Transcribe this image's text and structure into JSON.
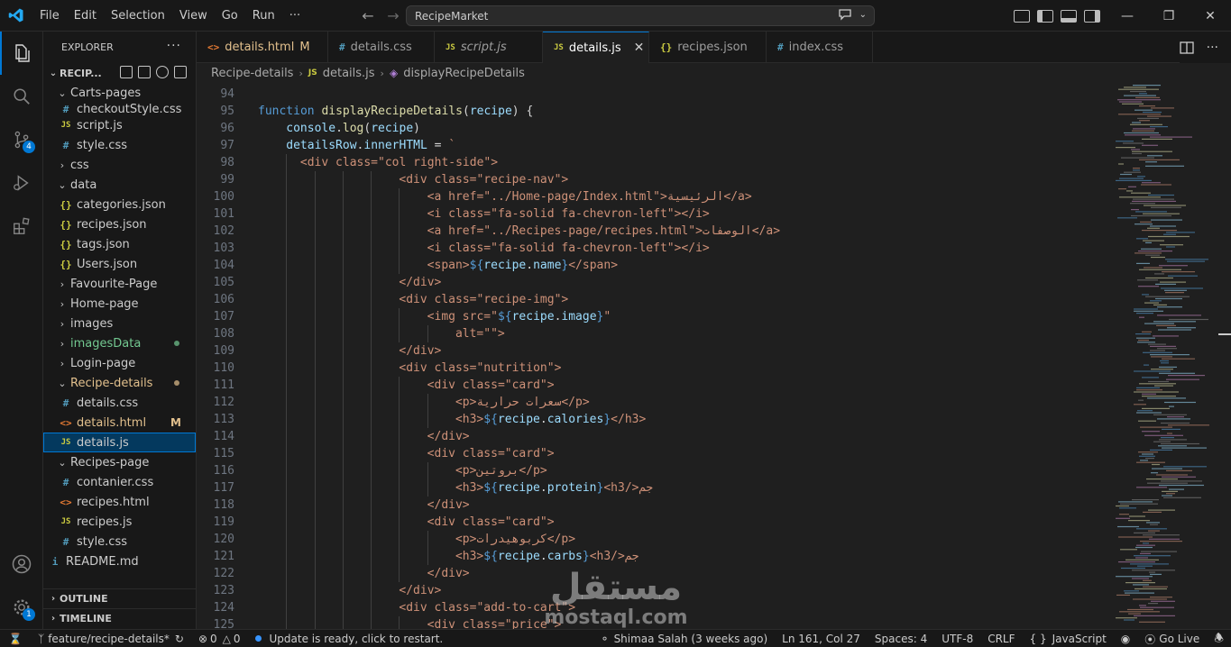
{
  "titlebar": {
    "menu": [
      "File",
      "Edit",
      "Selection",
      "View",
      "Go",
      "Run",
      "···"
    ],
    "search": "RecipeMarket"
  },
  "sidebar": {
    "title": "EXPLORER",
    "project": "RECIP...",
    "items": [
      {
        "label": "Carts-pages",
        "kind": "folder-open",
        "depth": 0
      },
      {
        "label": "checkoutStyle.css",
        "kind": "css",
        "depth": 1
      },
      {
        "label": "script.js",
        "kind": "js",
        "depth": 1
      },
      {
        "label": "style.css",
        "kind": "css",
        "depth": 1
      },
      {
        "label": "css",
        "kind": "folder",
        "depth": 0
      },
      {
        "label": "data",
        "kind": "folder-open",
        "depth": 0
      },
      {
        "label": "categories.json",
        "kind": "json",
        "depth": 1
      },
      {
        "label": "recipes.json",
        "kind": "json",
        "depth": 1
      },
      {
        "label": "tags.json",
        "kind": "json",
        "depth": 1
      },
      {
        "label": "Users.json",
        "kind": "json",
        "depth": 1
      },
      {
        "label": "Favourite-Page",
        "kind": "folder",
        "depth": 0
      },
      {
        "label": "Home-page",
        "kind": "folder",
        "depth": 0
      },
      {
        "label": "images",
        "kind": "folder",
        "depth": 0
      },
      {
        "label": "imagesData",
        "kind": "folder",
        "depth": 0,
        "status": "untracked"
      },
      {
        "label": "Login-page",
        "kind": "folder",
        "depth": 0
      },
      {
        "label": "Recipe-details",
        "kind": "folder-open",
        "depth": 0,
        "status": "modified"
      },
      {
        "label": "details.css",
        "kind": "css",
        "depth": 1
      },
      {
        "label": "details.html",
        "kind": "html",
        "depth": 1,
        "status": "modified",
        "mark": "M"
      },
      {
        "label": "details.js",
        "kind": "js",
        "depth": 1,
        "selected": true
      },
      {
        "label": "Recipes-page",
        "kind": "folder-open",
        "depth": 0
      },
      {
        "label": "contanier.css",
        "kind": "css",
        "depth": 1
      },
      {
        "label": "recipes.html",
        "kind": "html",
        "depth": 1
      },
      {
        "label": "recipes.js",
        "kind": "js",
        "depth": 1
      },
      {
        "label": "style.css",
        "kind": "css",
        "depth": 1
      },
      {
        "label": "README.md",
        "kind": "md",
        "depth": -1
      }
    ],
    "outline": "OUTLINE",
    "timeline": "TIMELINE"
  },
  "activity": {
    "source_control_badge": "4",
    "accounts_badge": "1"
  },
  "tabs": [
    {
      "label": "details.html",
      "kind": "html",
      "mark": "M",
      "modified": true
    },
    {
      "label": "details.css",
      "kind": "css"
    },
    {
      "label": "script.js",
      "kind": "js",
      "italic": true
    },
    {
      "label": "details.js",
      "kind": "js",
      "active": true
    },
    {
      "label": "recipes.json",
      "kind": "json"
    },
    {
      "label": "index.css",
      "kind": "css"
    }
  ],
  "breadcrumb": {
    "folder": "Recipe-details",
    "file": "details.js",
    "symbol": "displayRecipeDetails"
  },
  "editor": {
    "lines": [
      {
        "n": "94",
        "indent": 0,
        "tokens": []
      },
      {
        "n": "95",
        "indent": 0,
        "tokens": [
          [
            "function ",
            "kw"
          ],
          [
            "displayRecipeDetails",
            "fn"
          ],
          [
            "(",
            "p"
          ],
          [
            "recipe",
            "var"
          ],
          [
            ") {",
            "p"
          ]
        ]
      },
      {
        "n": "96",
        "indent": 4,
        "tokens": [
          [
            "console",
            "var"
          ],
          [
            ".",
            "p"
          ],
          [
            "log",
            "fn"
          ],
          [
            "(",
            "p"
          ],
          [
            "recipe",
            "var"
          ],
          [
            ")",
            "p"
          ]
        ]
      },
      {
        "n": "97",
        "indent": 4,
        "tokens": [
          [
            "detailsRow",
            "var"
          ],
          [
            ".",
            "p"
          ],
          [
            "innerHTML",
            "var"
          ],
          [
            " = ",
            "p"
          ],
          [
            "`",
            "str"
          ]
        ]
      },
      {
        "n": "98",
        "indent": 6,
        "tokens": [
          [
            "<div class=\"col right-side\">",
            "str"
          ]
        ]
      },
      {
        "n": "99",
        "indent": 20,
        "tokens": [
          [
            "<div class=\"recipe-nav\">",
            "str"
          ]
        ]
      },
      {
        "n": "100",
        "indent": 24,
        "tokens": [
          [
            "<a href=\"../Home-page/Index.html\">الرئيسية</a>",
            "str"
          ]
        ]
      },
      {
        "n": "101",
        "indent": 24,
        "tokens": [
          [
            "<i class=\"fa-solid fa-chevron-left\"></i>",
            "str"
          ]
        ]
      },
      {
        "n": "102",
        "indent": 24,
        "tokens": [
          [
            "<a href=\"../Recipes-page/recipes.html\">الوصفات</a>",
            "str"
          ]
        ]
      },
      {
        "n": "103",
        "indent": 24,
        "tokens": [
          [
            "<i class=\"fa-solid fa-chevron-left\"></i>",
            "str"
          ]
        ]
      },
      {
        "n": "104",
        "indent": 24,
        "tokens": [
          [
            "<span>",
            "str"
          ],
          [
            "${",
            "tpl"
          ],
          [
            "recipe",
            "var"
          ],
          [
            ".",
            "p"
          ],
          [
            "name",
            "var"
          ],
          [
            "}",
            "tpl"
          ],
          [
            "</span>",
            "str"
          ]
        ]
      },
      {
        "n": "105",
        "indent": 20,
        "tokens": [
          [
            "</div>",
            "str"
          ]
        ]
      },
      {
        "n": "106",
        "indent": 20,
        "tokens": [
          [
            "<div class=\"recipe-img\">",
            "str"
          ]
        ]
      },
      {
        "n": "107",
        "indent": 24,
        "tokens": [
          [
            "<img src=\"",
            "str"
          ],
          [
            "${",
            "tpl"
          ],
          [
            "recipe",
            "var"
          ],
          [
            ".",
            "p"
          ],
          [
            "image",
            "var"
          ],
          [
            "}",
            "tpl"
          ],
          [
            "\"",
            "str"
          ]
        ]
      },
      {
        "n": "108",
        "indent": 28,
        "tokens": [
          [
            "alt=\"\">",
            "str"
          ]
        ]
      },
      {
        "n": "109",
        "indent": 20,
        "tokens": [
          [
            "</div>",
            "str"
          ]
        ]
      },
      {
        "n": "110",
        "indent": 20,
        "tokens": [
          [
            "<div class=\"nutrition\">",
            "str"
          ]
        ]
      },
      {
        "n": "111",
        "indent": 24,
        "tokens": [
          [
            "<div class=\"card\">",
            "str"
          ]
        ]
      },
      {
        "n": "112",
        "indent": 28,
        "tokens": [
          [
            "<p>سعرات حرارية</p>",
            "str"
          ]
        ]
      },
      {
        "n": "113",
        "indent": 28,
        "tokens": [
          [
            "<h3>",
            "str"
          ],
          [
            "${",
            "tpl"
          ],
          [
            "recipe",
            "var"
          ],
          [
            ".",
            "p"
          ],
          [
            "calories",
            "var"
          ],
          [
            "}",
            "tpl"
          ],
          [
            "</h3>",
            "str"
          ]
        ]
      },
      {
        "n": "114",
        "indent": 24,
        "tokens": [
          [
            "</div>",
            "str"
          ]
        ]
      },
      {
        "n": "115",
        "indent": 24,
        "tokens": [
          [
            "<div class=\"card\">",
            "str"
          ]
        ]
      },
      {
        "n": "116",
        "indent": 28,
        "tokens": [
          [
            "<p>بروتين</p>",
            "str"
          ]
        ]
      },
      {
        "n": "117",
        "indent": 28,
        "tokens": [
          [
            "<h3>",
            "str"
          ],
          [
            "${",
            "tpl"
          ],
          [
            "recipe",
            "var"
          ],
          [
            ".",
            "p"
          ],
          [
            "protein",
            "var"
          ],
          [
            "}",
            "tpl"
          ],
          [
            " جم</h3>",
            "str"
          ]
        ]
      },
      {
        "n": "118",
        "indent": 24,
        "tokens": [
          [
            "</div>",
            "str"
          ]
        ]
      },
      {
        "n": "119",
        "indent": 24,
        "tokens": [
          [
            "<div class=\"card\">",
            "str"
          ]
        ]
      },
      {
        "n": "120",
        "indent": 28,
        "tokens": [
          [
            "<p>كربوهيدرات</p>",
            "str"
          ]
        ]
      },
      {
        "n": "121",
        "indent": 28,
        "tokens": [
          [
            "<h3>",
            "str"
          ],
          [
            "${",
            "tpl"
          ],
          [
            "recipe",
            "var"
          ],
          [
            ".",
            "p"
          ],
          [
            "carbs",
            "var"
          ],
          [
            "}",
            "tpl"
          ],
          [
            " جم</h3>",
            "str"
          ]
        ]
      },
      {
        "n": "122",
        "indent": 24,
        "tokens": [
          [
            "</div>",
            "str"
          ]
        ]
      },
      {
        "n": "123",
        "indent": 20,
        "tokens": [
          [
            "</div>",
            "str"
          ]
        ]
      },
      {
        "n": "124",
        "indent": 20,
        "tokens": [
          [
            "<div class=\"add-to-cart\">",
            "str"
          ]
        ]
      },
      {
        "n": "125",
        "indent": 24,
        "tokens": [
          [
            "<div class=\"price\">",
            "str"
          ]
        ]
      }
    ]
  },
  "watermark": {
    "ar": "مستقل",
    "en": "mostaql.com"
  },
  "statusbar": {
    "branch": "feature/recipe-details*",
    "errors": "0",
    "warnings": "0",
    "update": "Update is ready, click to restart.",
    "blame": "Shimaa Salah (3 weeks ago)",
    "position": "Ln 161, Col 27",
    "spaces": "Spaces: 4",
    "encoding": "UTF-8",
    "eol": "CRLF",
    "language": "JavaScript",
    "golive": "Go Live"
  },
  "colors": {
    "accent": "#0078d4",
    "keyword": "#569cd6",
    "function": "#dcdcaa",
    "variable": "#9cdcfe",
    "string": "#ce9178",
    "template": "#569cd6",
    "modified": "#e2c08d",
    "untracked": "#73c991"
  }
}
